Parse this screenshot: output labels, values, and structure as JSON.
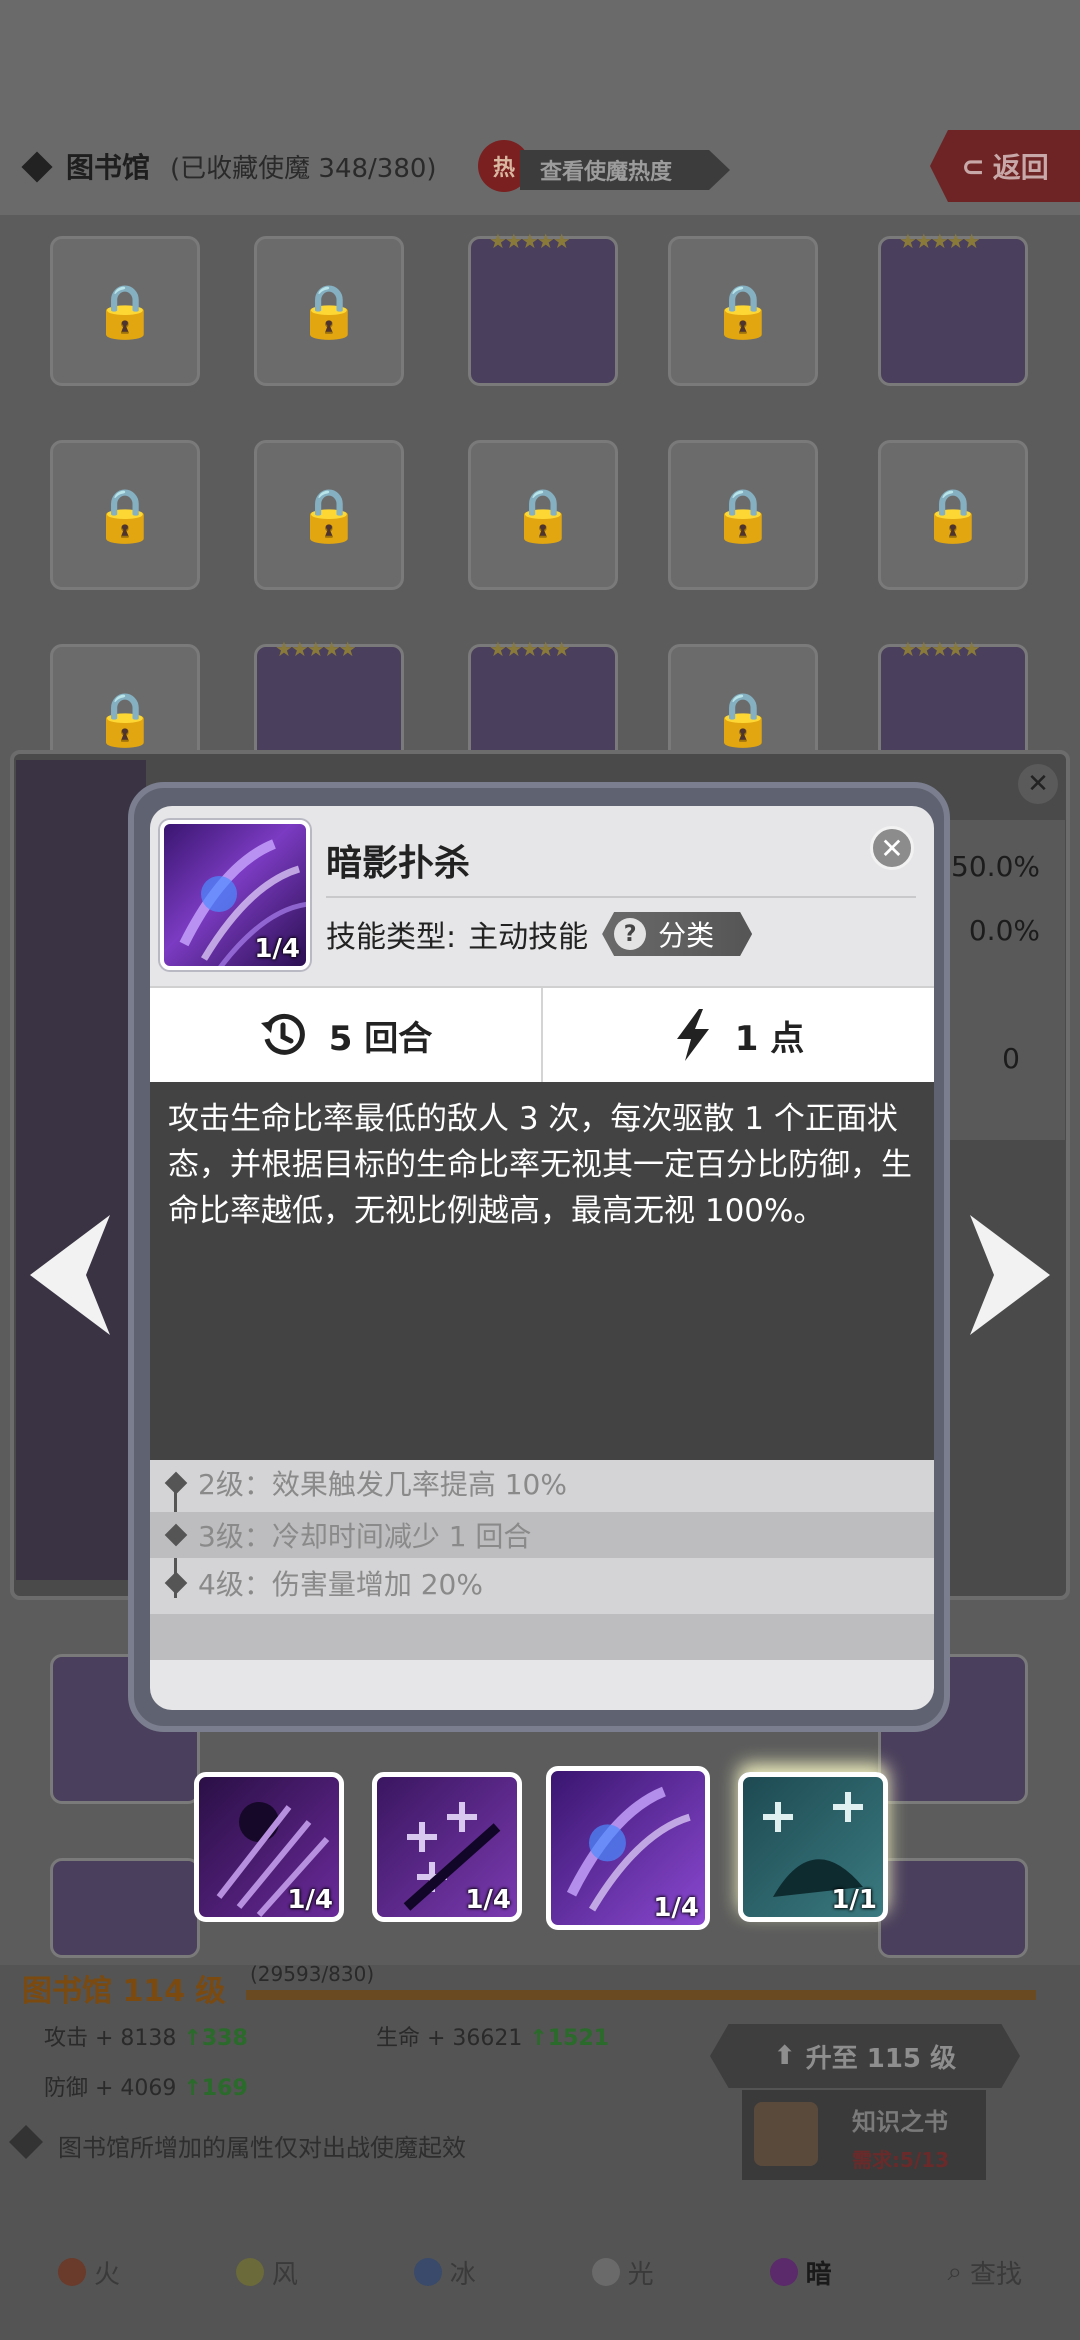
{
  "header": {
    "title": "图书馆",
    "collection": "(已收藏使魔 348/380)",
    "hot_badge": "热",
    "hot_label": "查看使魔热度",
    "back_label": "返回"
  },
  "under_panel": {
    "pct1": "50.0%",
    "pct2": "0.0%",
    "count": "0"
  },
  "popup": {
    "skill_name": "暗影扑杀",
    "skill_level": "1/4",
    "type_label": "技能类型:",
    "type_value": "主动技能",
    "category_label": "分类",
    "cooldown": "5 回合",
    "cost": "1 点",
    "description": "攻击生命比率最低的敌人 3 次，每次驱散 1 个正面状态，并根据目标的生命比率无视其一定百分比防御，生命比率越低，无视比例越高，最高无视 100%。",
    "upgrades": [
      "2级：效果触发几率提高 10%",
      "3级：冷却时间减少 1 回合",
      "4级：伤害量增加 20%"
    ]
  },
  "skills": [
    {
      "level": "1/4",
      "icon": "skull-claw-icon"
    },
    {
      "level": "1/4",
      "icon": "plus-slash-icon"
    },
    {
      "level": "1/4",
      "icon": "shadow-strike-icon"
    },
    {
      "level": "1/1",
      "icon": "teal-beast-icon"
    }
  ],
  "library": {
    "level": "图书馆 114 级",
    "xp": "(29593/830)",
    "atk_label": "攻击 + 8138",
    "atk_up": "338",
    "hp_label": "生命 + 36621",
    "hp_up": "1521",
    "def_label": "防御 + 4069",
    "def_up": "169",
    "upgrade_label": "升至 115 级",
    "book_name": "知识之书",
    "book_need": "需求:5/13",
    "note": "图书馆所增加的属性仅对出战使魔起效"
  },
  "tabs": [
    "火",
    "风",
    "冰",
    "光",
    "暗",
    "查找"
  ],
  "colors": {
    "popup_bg": "#e6e6e8",
    "desc_bg": "#434343",
    "accent_purple": "#7b3bc2"
  }
}
